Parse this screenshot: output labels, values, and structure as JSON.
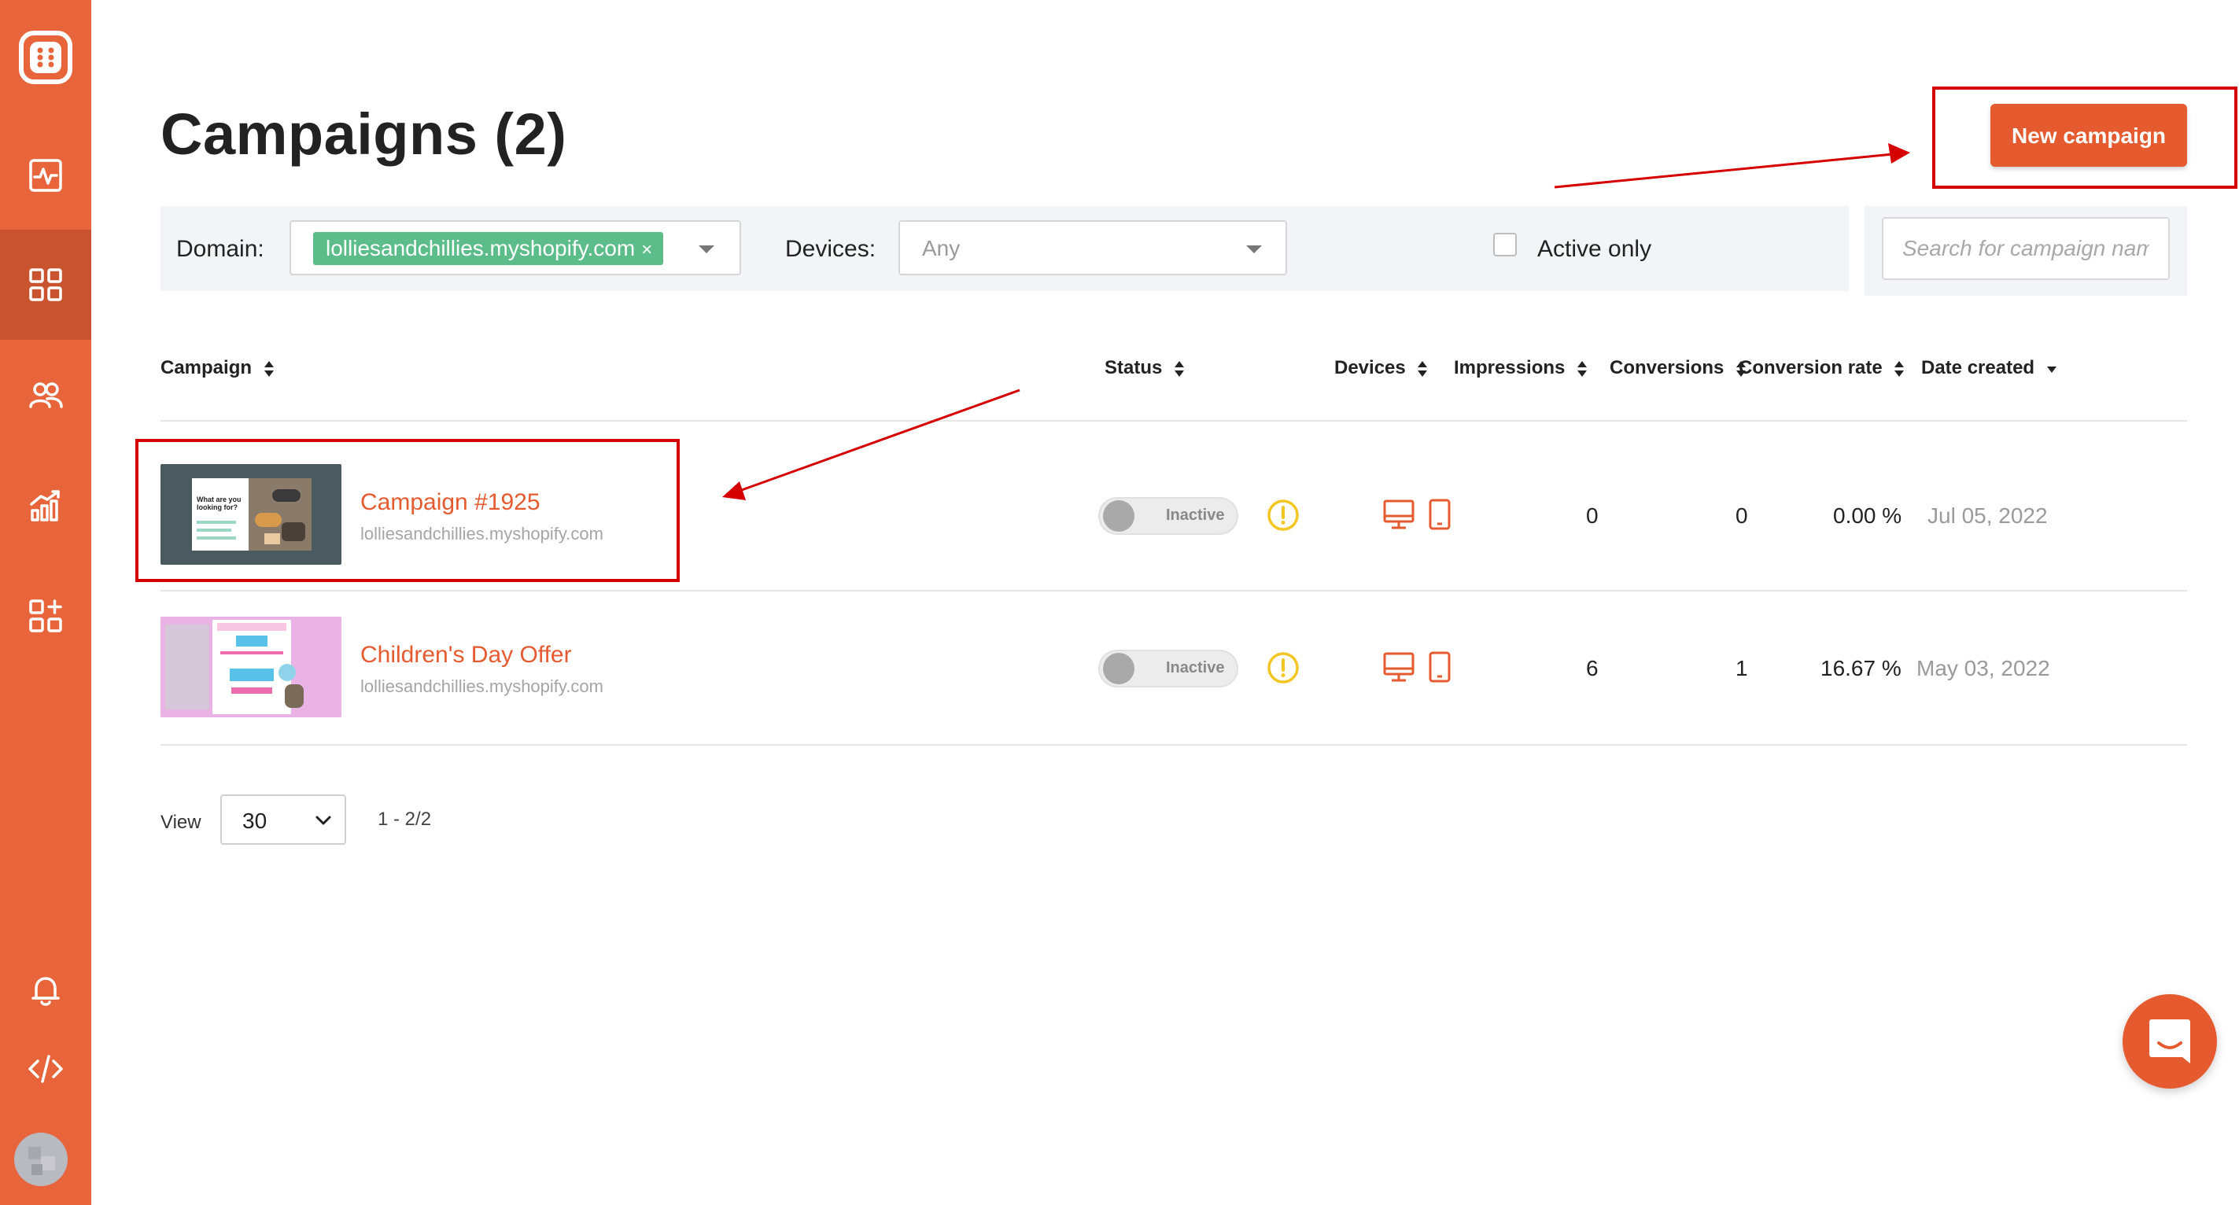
{
  "page": {
    "title": "Campaigns (2)",
    "new_campaign_label": "New campaign"
  },
  "filters": {
    "domain_label": "Domain:",
    "domain_value": "lolliesandchillies.myshopify.com",
    "domain_clear": "×",
    "devices_label": "Devices:",
    "devices_value": "Any",
    "active_only_label": "Active only",
    "search_placeholder": "Search for campaign name"
  },
  "table": {
    "headers": {
      "campaign": "Campaign",
      "status": "Status",
      "devices": "Devices",
      "impressions": "Impressions",
      "conversions": "Conversions",
      "conversion_rate": "Conversion rate",
      "date_created": "Date created"
    },
    "rows": [
      {
        "name": "Campaign #1925",
        "domain": "lolliesandchillies.myshopify.com",
        "status": "Inactive",
        "impressions": "0",
        "conversions": "0",
        "conversion_rate": "0.00 %",
        "date_created": "Jul 05, 2022",
        "thumb_text": "What are you looking for?"
      },
      {
        "name": "Children's Day Offer",
        "domain": "lolliesandchillies.myshopify.com",
        "status": "Inactive",
        "impressions": "6",
        "conversions": "1",
        "conversion_rate": "16.67 %",
        "date_created": "May 03, 2022"
      }
    ]
  },
  "pagination": {
    "view_label": "View",
    "per_page": "30",
    "range": "1 - 2/2"
  },
  "icons": {
    "logo": "app-logo-icon",
    "sidebar": [
      "activity-icon",
      "grid-icon",
      "users-icon",
      "analytics-icon",
      "add-widget-icon",
      "bell-icon",
      "code-icon"
    ]
  },
  "colors": {
    "brand": "#e8643b",
    "accent": "#e55a2f",
    "tag_green": "#5dbd8a",
    "annotation_red": "#d50000",
    "warning_yellow": "#f3c623"
  }
}
